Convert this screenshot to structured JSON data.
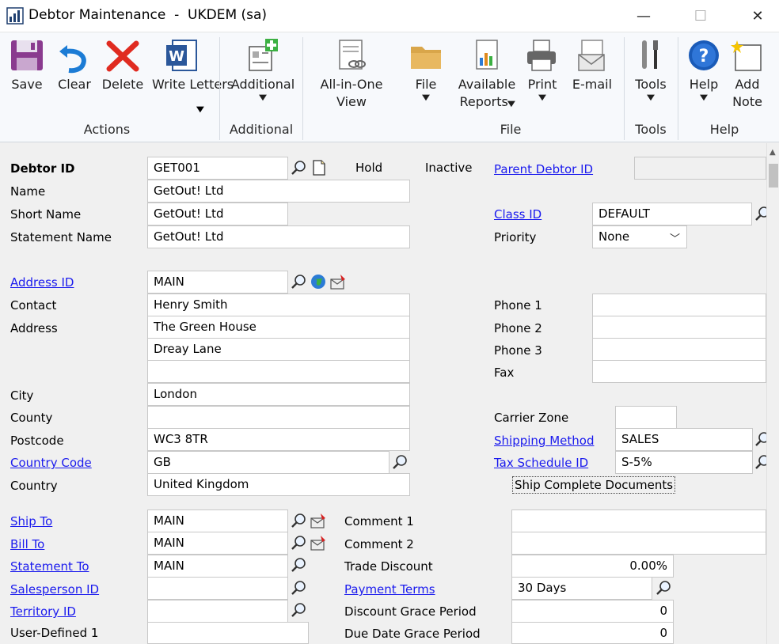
{
  "window": {
    "title": "Debtor Maintenance  -  UKDEM (sa)",
    "minimize": "—",
    "maximize": "☐",
    "close": "✕"
  },
  "ribbon": {
    "save": "Save",
    "clear": "Clear",
    "delete": "Delete",
    "write_letters": "Write Letters",
    "additional": "Additional",
    "all_in_one_1": "All-in-One",
    "all_in_one_2": "View",
    "file": "File",
    "available_reports_1": "Available",
    "available_reports_2": "Reports",
    "print": "Print",
    "email": "E-mail",
    "tools": "Tools",
    "help": "Help",
    "add_note_1": "Add",
    "add_note_2": "Note",
    "groups": {
      "actions": "Actions",
      "additional": "Additional",
      "file": "File",
      "tools": "Tools",
      "help": "Help"
    }
  },
  "form": {
    "debtor_id_label": "Debtor ID",
    "debtor_id": "GET001",
    "hold_label": "Hold",
    "inactive_label": "Inactive",
    "parent_debtor_id_label": "Parent Debtor ID",
    "parent_debtor_id": "",
    "name_label": "Name",
    "name": "GetOut! Ltd",
    "short_name_label": "Short Name",
    "short_name": "GetOut! Ltd",
    "statement_name_label": "Statement Name",
    "statement_name": "GetOut! Ltd",
    "class_id_label": "Class ID",
    "class_id": "DEFAULT",
    "priority_label": "Priority",
    "priority": "None",
    "address_id_label": "Address ID",
    "address_id": "MAIN",
    "contact_label": "Contact",
    "contact": "Henry Smith",
    "address_label": "Address",
    "address1": "The Green House",
    "address2": "Dreay Lane",
    "address3": "",
    "city_label": "City",
    "city": "London",
    "county_label": "County",
    "county": "",
    "postcode_label": "Postcode",
    "postcode": "WC3 8TR",
    "country_code_label": "Country Code",
    "country_code": "GB",
    "country_label": "Country",
    "country": "United Kingdom",
    "phone1_label": "Phone 1",
    "phone1": "",
    "phone2_label": "Phone 2",
    "phone2": "",
    "phone3_label": "Phone 3",
    "phone3": "",
    "fax_label": "Fax",
    "fax": "",
    "carrier_zone_label": "Carrier Zone",
    "carrier_zone": "",
    "shipping_method_label": "Shipping Method",
    "shipping_method": "SALES",
    "tax_schedule_id_label": "Tax Schedule ID",
    "tax_schedule_id": "S-5%",
    "ship_complete_label": "Ship Complete Documents",
    "ship_to_label": "Ship To",
    "ship_to": "MAIN",
    "bill_to_label": "Bill To",
    "bill_to": "MAIN",
    "statement_to_label": "Statement To",
    "statement_to": "MAIN",
    "salesperson_id_label": "Salesperson ID",
    "salesperson_id": "",
    "territory_id_label": "Territory ID",
    "territory_id": "",
    "user_defined1_label": "User-Defined 1",
    "user_defined1": "",
    "comment1_label": "Comment 1",
    "comment1": "",
    "comment2_label": "Comment 2",
    "comment2": "",
    "trade_discount_label": "Trade Discount",
    "trade_discount": "0.00%",
    "payment_terms_label": "Payment Terms",
    "payment_terms": "30 Days",
    "discount_grace_label": "Discount Grace Period",
    "discount_grace": "0",
    "due_date_grace_label": "Due Date Grace Period",
    "due_date_grace": "0"
  }
}
